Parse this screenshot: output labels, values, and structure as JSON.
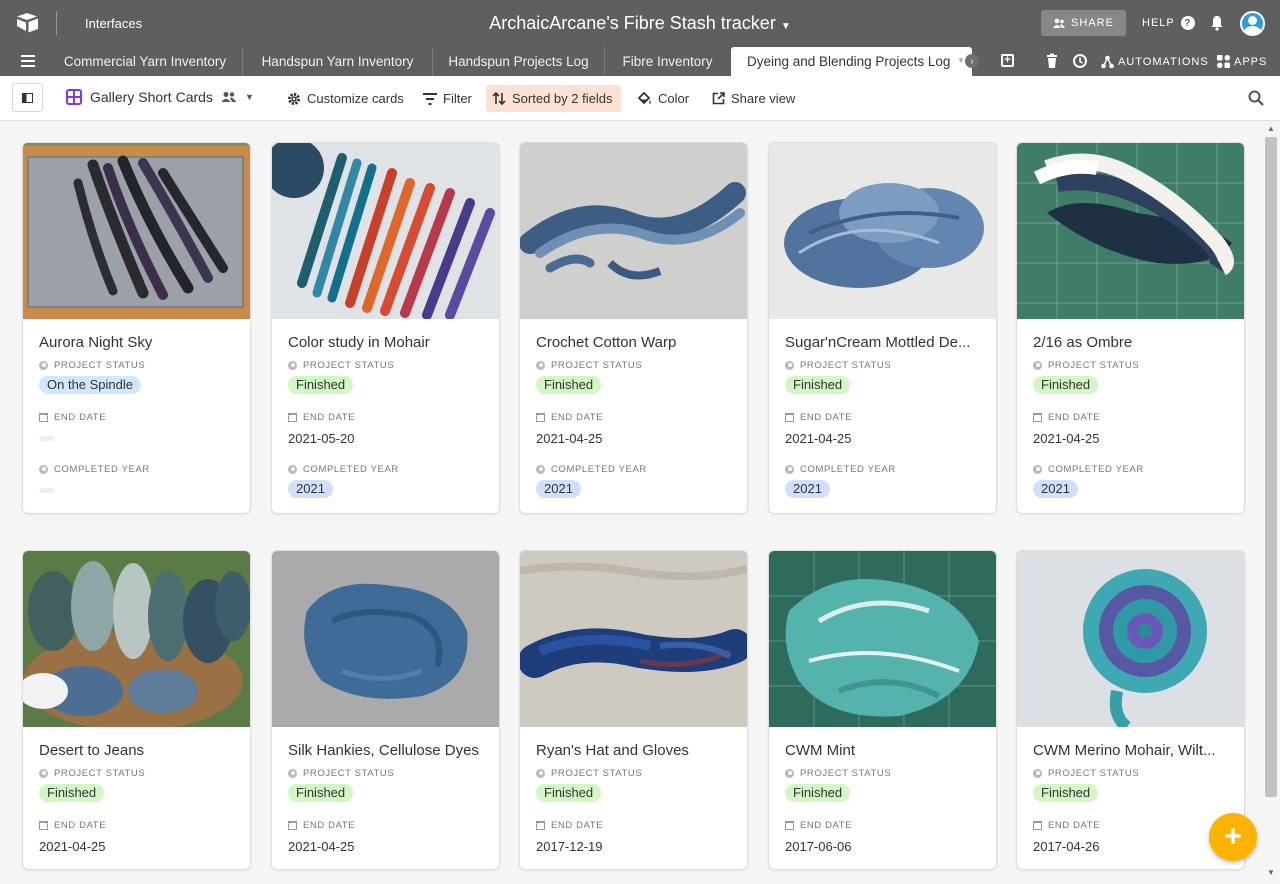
{
  "header": {
    "interfaces_label": "Interfaces",
    "base_title": "ArchaicArcane's Fibre Stash tracker",
    "share_label": "SHARE",
    "help_label": "HELP"
  },
  "tabs": [
    {
      "label": "Commercial Yarn Inventory"
    },
    {
      "label": "Handspun Yarn Inventory"
    },
    {
      "label": "Handspun Projects Log"
    },
    {
      "label": "Fibre Inventory"
    },
    {
      "label": "Dyeing and Blending Projects Log"
    }
  ],
  "tabbar": {
    "automations_label": "AUTOMATIONS",
    "apps_label": "APPS"
  },
  "viewbar": {
    "view_name": "Gallery Short Cards",
    "customize": "Customize cards",
    "filter": "Filter",
    "sorted": "Sorted by 2 fields",
    "color": "Color",
    "share_view": "Share view"
  },
  "field_labels": {
    "status": "PROJECT STATUS",
    "end_date": "END DATE",
    "year": "COMPLETED YEAR"
  },
  "cards": [
    {
      "title": "Aurora Night Sky",
      "status": "On the Spindle",
      "end_date": "",
      "year": ""
    },
    {
      "title": "Color study in Mohair",
      "status": "Finished",
      "end_date": "2021-05-20",
      "year": "2021"
    },
    {
      "title": "Crochet Cotton Warp",
      "status": "Finished",
      "end_date": "2021-04-25",
      "year": "2021"
    },
    {
      "title": "Sugar'nCream Mottled De...",
      "status": "Finished",
      "end_date": "2021-04-25",
      "year": "2021"
    },
    {
      "title": "2/16 as Ombre",
      "status": "Finished",
      "end_date": "2021-04-25",
      "year": "2021"
    },
    {
      "title": "Desert to Jeans",
      "status": "Finished",
      "end_date": "2021-04-25",
      "year": ""
    },
    {
      "title": "Silk Hankies, Cellulose Dyes",
      "status": "Finished",
      "end_date": "2021-04-25",
      "year": ""
    },
    {
      "title": "Ryan's Hat and Gloves",
      "status": "Finished",
      "end_date": "2017-12-19",
      "year": ""
    },
    {
      "title": "CWM Mint",
      "status": "Finished",
      "end_date": "2017-06-06",
      "year": ""
    },
    {
      "title": "CWM Merino Mohair, Wilt...",
      "status": "Finished",
      "end_date": "2017-04-26",
      "year": ""
    }
  ],
  "colors": {
    "topbar": "#5f5f5f",
    "finished_pill": "#d1f7c4",
    "spindle_pill": "#cfe8ff",
    "year_pill": "#d0e0fc",
    "sorted_bg": "#fde1d5",
    "fab": "#fcb400"
  },
  "icons": [
    "airtable-logo-icon",
    "caret-down-icon",
    "share-people-icon",
    "help-icon",
    "bell-icon",
    "avatar",
    "hamburger-icon",
    "plus-square-icon",
    "trash-icon",
    "history-icon",
    "automations-icon",
    "apps-icon",
    "sidebar-toggle-icon",
    "gallery-icon",
    "people-icon",
    "gear-icon",
    "filter-icon",
    "sort-icon",
    "paint-bucket-icon",
    "share-view-icon",
    "search-icon",
    "plus-icon"
  ]
}
